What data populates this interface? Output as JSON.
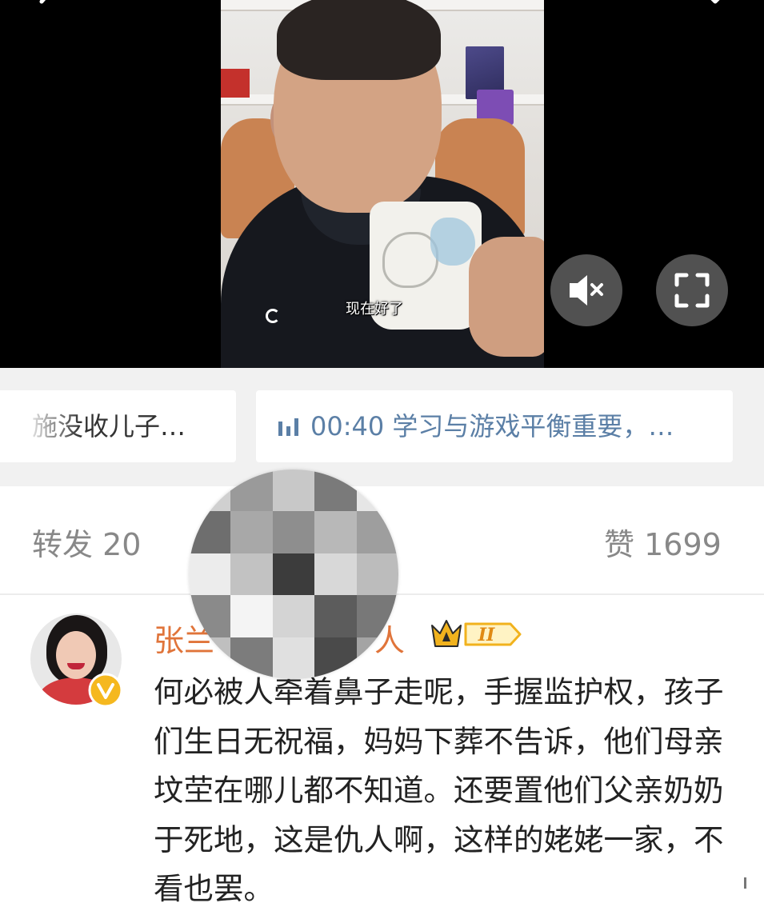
{
  "video": {
    "subtitle": "现在好了",
    "mute_button_label": "mute",
    "fullscreen_button_label": "fullscreen"
  },
  "chips": {
    "left_text": "施没收儿子…",
    "right_time": "00:40",
    "right_text": "学习与游戏平衡重要，…"
  },
  "stats": {
    "repost_label": "转发",
    "repost_count": "20",
    "like_label": "赞",
    "like_count": "1699"
  },
  "comment": {
    "username_prefix": "张兰",
    "username_suffix": "人",
    "vip_level": "II",
    "text": "何必被人牵着鼻子走呢，手握监护权，孩子们生日无祝福，妈妈下葬不告诉，他们母亲坟茔在哪儿都不知道。还要置他们父亲奶奶于死地，这是仇人啊，这样的姥姥一家，不看也罢。"
  },
  "colors": {
    "username": "#e0743a",
    "link_blue": "#5b7fa6",
    "stat_gray": "#888888",
    "badge_gold": "#f5b81f"
  },
  "icons": {
    "mute": "speaker-muted-icon",
    "fullscreen": "fullscreen-corners-icon",
    "audio_bars": "audio-bars-icon",
    "verified": "verified-v-icon",
    "vip": "crown-vip-icon"
  }
}
